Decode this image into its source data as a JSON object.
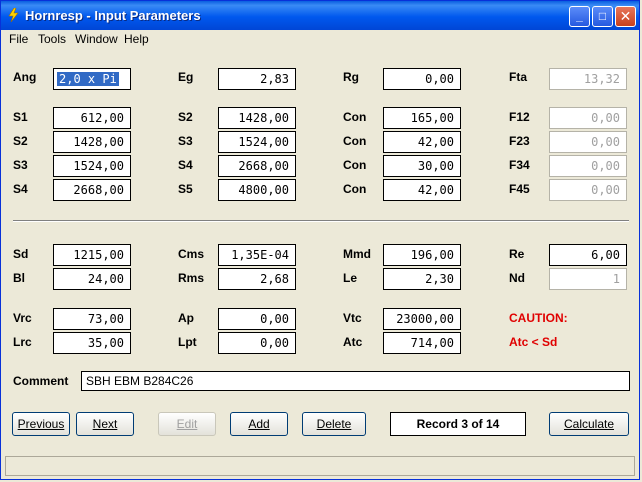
{
  "window": {
    "title": "Hornresp - Input Parameters"
  },
  "menu": [
    "File",
    "Tools",
    "Window",
    "Help"
  ],
  "caption_buttons": {
    "minimize": "_",
    "maximize": "□",
    "close": "✕"
  },
  "row1": {
    "ang": {
      "label": "Ang",
      "value": "2,0 x Pi"
    },
    "eg": {
      "label": "Eg",
      "value": "2,83"
    },
    "rg": {
      "label": "Rg",
      "value": "0,00"
    },
    "fta": {
      "label": "Fta",
      "value": "13,32"
    }
  },
  "col1": [
    {
      "label": "S1",
      "value": "612,00"
    },
    {
      "label": "S2",
      "value": "1428,00"
    },
    {
      "label": "S3",
      "value": "1524,00"
    },
    {
      "label": "S4",
      "value": "2668,00"
    }
  ],
  "col2": [
    {
      "label": "S2",
      "value": "1428,00"
    },
    {
      "label": "S3",
      "value": "1524,00"
    },
    {
      "label": "S4",
      "value": "2668,00"
    },
    {
      "label": "S5",
      "value": "4800,00"
    }
  ],
  "col3": [
    {
      "label": "Con",
      "value": "165,00"
    },
    {
      "label": "Con",
      "value": "42,00"
    },
    {
      "label": "Con",
      "value": "30,00"
    },
    {
      "label": "Con",
      "value": "42,00"
    }
  ],
  "col4": [
    {
      "label": "F12",
      "value": "0,00"
    },
    {
      "label": "F23",
      "value": "0,00"
    },
    {
      "label": "F34",
      "value": "0,00"
    },
    {
      "label": "F45",
      "value": "0,00"
    }
  ],
  "driver": {
    "sd": {
      "label": "Sd",
      "value": "1215,00"
    },
    "cms": {
      "label": "Cms",
      "value": "1,35E-04"
    },
    "mmd": {
      "label": "Mmd",
      "value": "196,00"
    },
    "re": {
      "label": "Re",
      "value": "6,00"
    },
    "bl": {
      "label": "Bl",
      "value": "24,00"
    },
    "rms": {
      "label": "Rms",
      "value": "2,68"
    },
    "le": {
      "label": "Le",
      "value": "2,30"
    },
    "nd": {
      "label": "Nd",
      "value": "1"
    }
  },
  "chamber": {
    "vrc": {
      "label": "Vrc",
      "value": "73,00"
    },
    "ap": {
      "label": "Ap",
      "value": "0,00"
    },
    "vtc": {
      "label": "Vtc",
      "value": "23000,00"
    },
    "lrc": {
      "label": "Lrc",
      "value": "35,00"
    },
    "lpt": {
      "label": "Lpt",
      "value": "0,00"
    },
    "atc": {
      "label": "Atc",
      "value": "714,00"
    }
  },
  "caution": {
    "title": "CAUTION:",
    "message": "Atc < Sd",
    "color": "#e00000"
  },
  "comment": {
    "label": "Comment",
    "value": "SBH  EBM B284C26"
  },
  "buttons": {
    "previous": "Previous",
    "next": "Next",
    "edit": "Edit",
    "add": "Add",
    "delete": "Delete",
    "calculate": "Calculate"
  },
  "record": "Record 3 of 14",
  "icons": {
    "app": "lightning-icon"
  }
}
